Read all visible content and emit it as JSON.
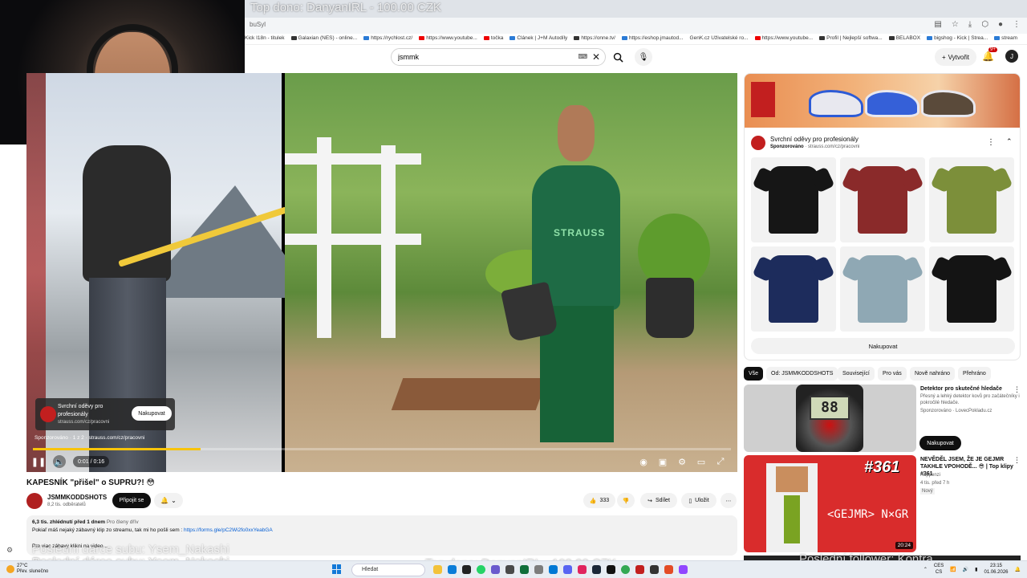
{
  "stream_overlay": {
    "top_donation": "Top dono: DanyanIRL - 100.00 CZK",
    "bottom_left": "Poslední dárce subu: Ysem_Nakashi",
    "bottom_left_ghost": "Poslední dárce subu: Ysem_Nakashi",
    "bottom_center": "Top dono: DanyanIRL - 100.00 CZK",
    "bottom_right": "Poslední follower: Kontra..."
  },
  "browser": {
    "url_fragment": "buSyl",
    "bookmarks": [
      "Kick I18n - titulek",
      "Galaxian (NES) - online...",
      "https://rychlost.cz/",
      "https://www.youtube...",
      "točka",
      "Článek | J+M Autodíly",
      "https://onne.tv/",
      "https://eshop.jmautod...",
      "GenK.cz Uživatelské ro...",
      "https://www.youtube...",
      "Profil | Nejlepší softwa...",
      "BELABOX",
      "bigshog - Kick | Strea...",
      "stream",
      "gpt"
    ]
  },
  "yt_header": {
    "search_value": "jsmmk",
    "create_label": "Vytvořit",
    "notif_count": "9+"
  },
  "player": {
    "ad_title": "Svrchní oděvy pro profesionály",
    "ad_domain": "strauss.com/cz/pracovni",
    "ad_button": "Nakupovat",
    "sponsor_line": "Sponzorováno · 1 z 2 · strauss.com/cz/pracovni",
    "time": "0:01 / 0:16",
    "progress_fraction": 0.24,
    "logo_text": "STRAUSS"
  },
  "video": {
    "title": "KAPESNÍK \"přišel\" o SUPRU?! 😳",
    "channel": "JSMMKODDSHOTS",
    "subscribers": "8,2 tis. odběratelů",
    "join_label": "Připojit se",
    "likes": "333",
    "share_label": "Sdílet",
    "save_label": "Uložit",
    "views_date": "6,3 tis. zhlédnutí  před 1 dnem",
    "members_note": "Pro členy dřív",
    "desc_line": "Pokiaľ máš nejaký zábavný klip zo streamu, tak mi ho pošli sem : ",
    "desc_link": "https://forms.gle/pC2Wi2fo0xxYeabGA",
    "desc_line2": "Pre viac zábavy klikni na video..."
  },
  "ad_card": {
    "title": "Svrchní oděvy pro profesionály",
    "sponsored": "Sponzorováno",
    "domain": "· strauss.com/cz/pracovni",
    "shop_label": "Nakupovat",
    "products": [
      {
        "name": "black-tshirt",
        "color": "#161616"
      },
      {
        "name": "plaid-shirt",
        "color": "#8a2a2a"
      },
      {
        "name": "olive-tshirt",
        "color": "#7c8f3a"
      },
      {
        "name": "navy-fleece",
        "color": "#1d2c5c"
      },
      {
        "name": "grey-blue-tshirt",
        "color": "#8fa8b4"
      },
      {
        "name": "black-tshirt-2",
        "color": "#141414"
      }
    ]
  },
  "chips": [
    "Vše",
    "Od: JSMMKODDSHOTS",
    "Související",
    "Pro vás",
    "Nově nahráno",
    "Přehráno"
  ],
  "recs": [
    {
      "title": "Detektor pro skutečné hledače",
      "desc": "Přesný a lehký detektor kovů pro začátečníky i pokročilé hledače.",
      "meta": "Sponzorováno · LovecPokladu.cz",
      "button": "Nakupovat",
      "screen": "88"
    },
    {
      "title": "NEVĚDĚL JSEM, ŽE JE GEJMR TAKHLE VPOHODĚ... 😎 | Top klipy #361",
      "channel": "Kappenzi",
      "meta": "4 tis.  před 7 h",
      "badge": "Nový",
      "thumb_number": "#361",
      "thumb_text": "<GEJMR> N×GR",
      "duration": "20:24"
    }
  ],
  "taskbar": {
    "weather_temp": "27°C",
    "weather_desc": "Přev. slunečno",
    "search_placeholder": "Hledat",
    "lang": "CES",
    "lang2": "CS",
    "time": "23:15",
    "date": "01.06.2026"
  }
}
